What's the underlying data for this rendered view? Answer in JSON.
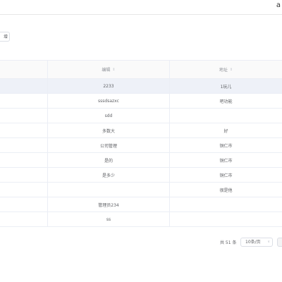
{
  "topbar": {
    "user_text": "a"
  },
  "toolbar": {
    "button_label": "增"
  },
  "table": {
    "columns": [
      {
        "label": ""
      },
      {
        "label": "编辑"
      },
      {
        "label": "地址"
      }
    ],
    "sort_icon": "⇕",
    "rows": [
      {
        "c1": "2233",
        "c2": "1玩儿"
      },
      {
        "c1": "sssdsazxc",
        "c2": "吧功能"
      },
      {
        "c1": "sdd",
        "c2": ""
      },
      {
        "c1": "多数大",
        "c2": "好"
      },
      {
        "c1": "公司管理",
        "c2": "铜仁市"
      },
      {
        "c1": "是的",
        "c2": "铜仁市"
      },
      {
        "c1": "是多少",
        "c2": "铜仁市"
      },
      {
        "c1": "",
        "c2": "很是他"
      },
      {
        "c1": "管理员234",
        "c2": ""
      },
      {
        "c1": "ss",
        "c2": ""
      }
    ]
  },
  "pager": {
    "total_text": "共 51 条",
    "page_size": "10条/页",
    "dropdown_icon": "∨"
  }
}
